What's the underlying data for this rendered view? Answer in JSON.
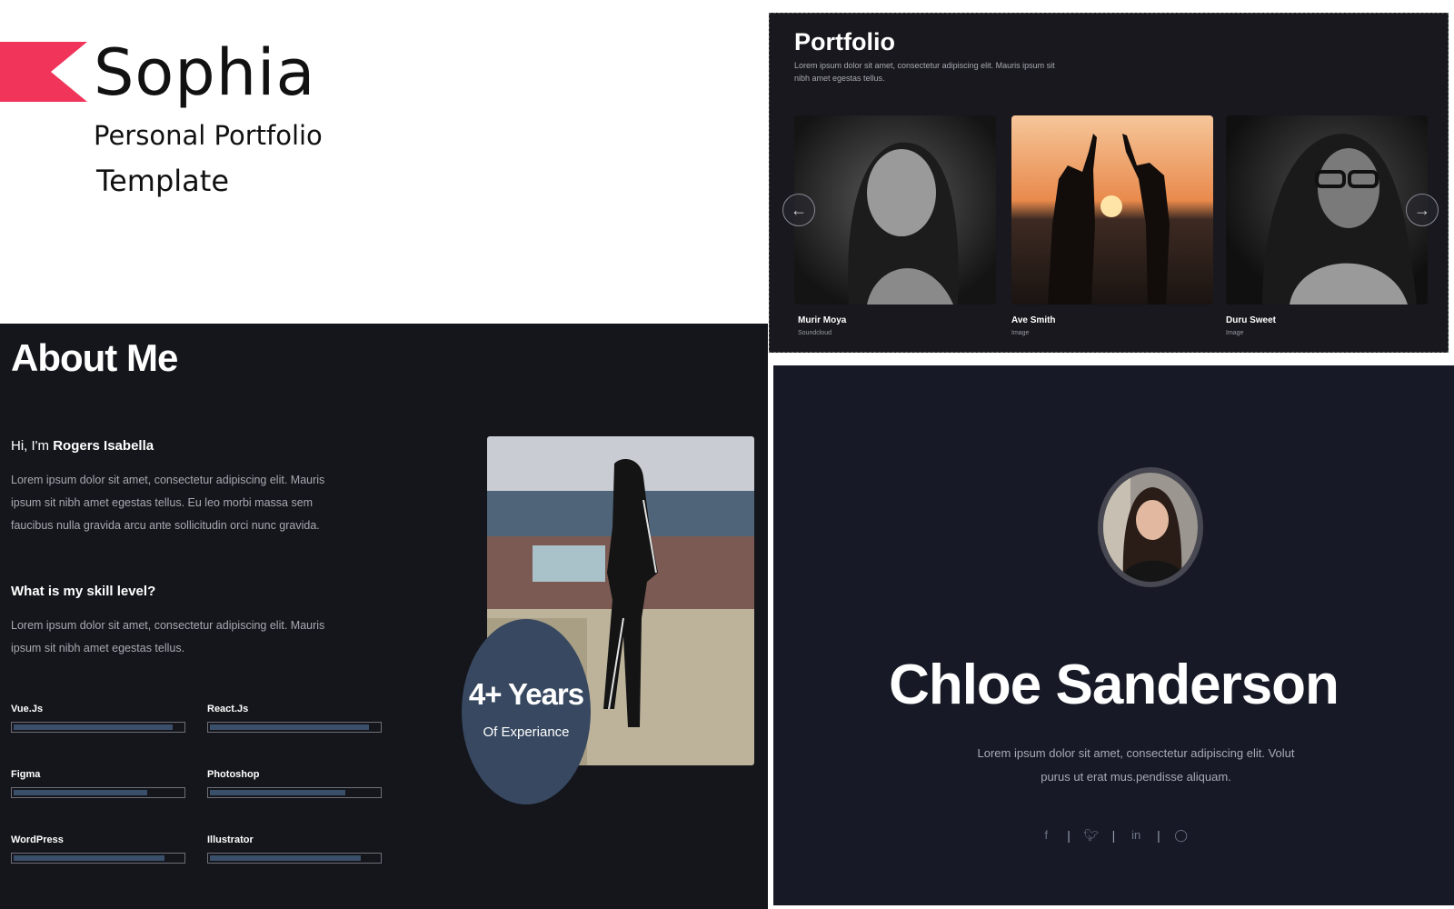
{
  "brand": {
    "name": "Sophia",
    "subtitle_line1": "Personal Portfolio",
    "subtitle_line2": "Template",
    "accent_color": "#f0345a"
  },
  "portfolio": {
    "title": "Portfolio",
    "description": "Lorem ipsum dolor sit amet, consectetur adipiscing elit. Mauris ipsum sit nibh amet egestas tellus.",
    "prev_icon": "arrow-left-icon",
    "next_icon": "arrow-right-icon",
    "items": [
      {
        "name": "Murir Moya",
        "type": "Soundcloud"
      },
      {
        "name": "Ave Smith",
        "type": "Image"
      },
      {
        "name": "Duru Sweet",
        "type": "Image"
      }
    ]
  },
  "about": {
    "title": "About Me",
    "greeting": "Hi, I'm",
    "person_name": "Rogers Isabella",
    "paragraph1": "Lorem ipsum dolor sit amet, consectetur adipiscing elit. Mauris ipsum sit nibh amet egestas tellus. Eu leo morbi massa sem faucibus nulla gravida arcu ante sollicitudin orci nunc gravida.",
    "skill_heading": "What is my skill level?",
    "paragraph2": "Lorem ipsum dolor sit amet, consectetur adipiscing elit. Mauris ipsum sit nibh amet egestas tellus.",
    "skills": [
      {
        "label": "Vue.Js",
        "level": 0.94
      },
      {
        "label": "React.Js",
        "level": 0.94
      },
      {
        "label": "Figma",
        "level": 0.79
      },
      {
        "label": "Photoshop",
        "level": 0.8
      },
      {
        "label": "WordPress",
        "level": 0.89
      },
      {
        "label": "Illustrator",
        "level": 0.89
      }
    ],
    "experience_years": "4+ Years",
    "experience_label": "Of Experiance"
  },
  "hero": {
    "name": "Chloe Sanderson",
    "text": "Lorem ipsum dolor sit amet, consectetur adipiscing elit. Volut purus ut erat mus.pendisse aliquam.",
    "social_icons": [
      "facebook-icon",
      "twitter-icon",
      "linkedin-icon",
      "dribbble-icon"
    ]
  }
}
